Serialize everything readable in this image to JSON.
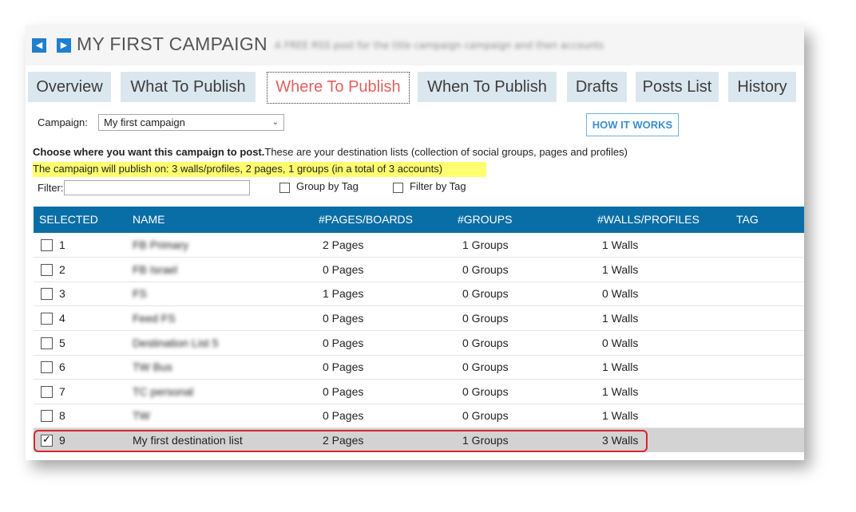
{
  "header": {
    "title": "MY FIRST CAMPAIGN",
    "subtitle_blurred": "A FREE RSS post for the title campaign campaign and then accounts"
  },
  "tabs": [
    {
      "label": "Overview"
    },
    {
      "label": "What To Publish"
    },
    {
      "label": "Where To Publish",
      "active": true
    },
    {
      "label": "When To Publish"
    },
    {
      "label": "Drafts"
    },
    {
      "label": "Posts List"
    },
    {
      "label": "History"
    }
  ],
  "campaign": {
    "label": "Campaign:",
    "selected": "My first campaign"
  },
  "how_it_works": "HOW IT WORKS",
  "instructions": {
    "bold": "Choose where you want this campaign to post.",
    "rest": "These are your destination lists (collection of social groups, pages and profiles)",
    "summary": "The campaign will publish on: 3 walls/profiles, 2 pages, 1 groups (in a total of 3 accounts)"
  },
  "filter": {
    "label": "Filter:",
    "value": "",
    "group_by_tag": "Group by Tag",
    "filter_by_tag": "Filter by Tag"
  },
  "table": {
    "headers": [
      "SELECTED",
      "NAME",
      "#PAGES/BOARDS",
      "#GROUPS",
      "#WALLS/PROFILES",
      "TAG"
    ],
    "rows": [
      {
        "num": "1",
        "name": "FB Primary",
        "pages": "2 Pages",
        "groups": "1 Groups",
        "walls": "1 Walls",
        "checked": false
      },
      {
        "num": "2",
        "name": "FB Israel",
        "pages": "0 Pages",
        "groups": "0 Groups",
        "walls": "1 Walls",
        "checked": false
      },
      {
        "num": "3",
        "name": "FS",
        "pages": "1 Pages",
        "groups": "0 Groups",
        "walls": "0 Walls",
        "checked": false
      },
      {
        "num": "4",
        "name": "Feed FS",
        "pages": "0 Pages",
        "groups": "0 Groups",
        "walls": "1 Walls",
        "checked": false
      },
      {
        "num": "5",
        "name": "Destination List 5",
        "pages": "0 Pages",
        "groups": "0 Groups",
        "walls": "0 Walls",
        "checked": false
      },
      {
        "num": "6",
        "name": "TW Bus",
        "pages": "0 Pages",
        "groups": "0 Groups",
        "walls": "1 Walls",
        "checked": false
      },
      {
        "num": "7",
        "name": "TC personal",
        "pages": "0 Pages",
        "groups": "0 Groups",
        "walls": "1 Walls",
        "checked": false
      },
      {
        "num": "8",
        "name": "TW",
        "pages": "0 Pages",
        "groups": "0 Groups",
        "walls": "1 Walls",
        "checked": false
      },
      {
        "num": "9",
        "name": "My first destination list",
        "pages": "2 Pages",
        "groups": "1 Groups",
        "walls": "3 Walls",
        "checked": true
      }
    ]
  },
  "colors": {
    "accent": "#0a6ea6",
    "active_tab_text": "#e06060",
    "highlight": "#ffff70",
    "selection_border": "#d8262a"
  }
}
